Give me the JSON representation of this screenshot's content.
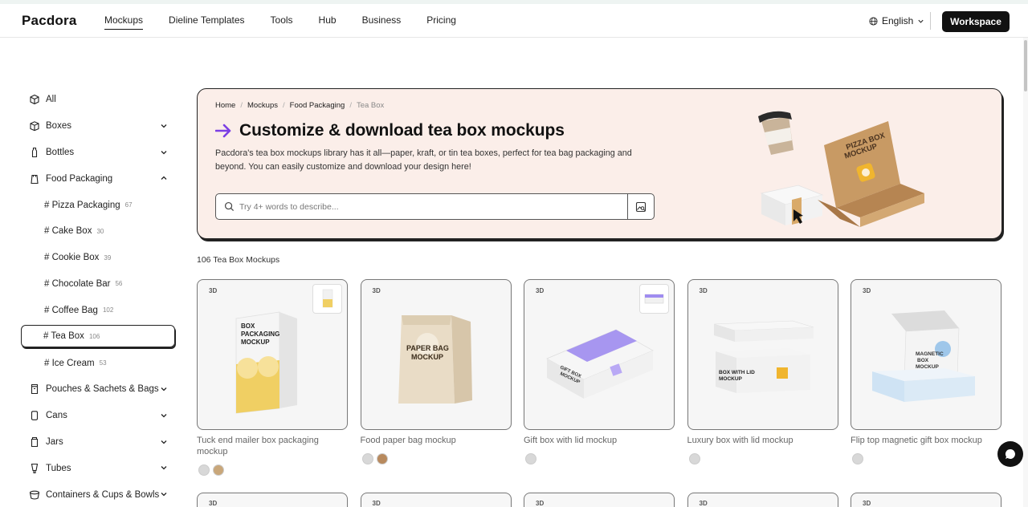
{
  "header": {
    "logo": "Pacdora",
    "nav": [
      "Mockups",
      "Dieline Templates",
      "Tools",
      "Hub",
      "Business",
      "Pricing"
    ],
    "language": "English",
    "workspace_label": "Workspace"
  },
  "sidebar": {
    "items": [
      {
        "label": "All",
        "icon": "cube-icon"
      },
      {
        "label": "Boxes",
        "icon": "box-icon"
      },
      {
        "label": "Bottles",
        "icon": "bottle-icon"
      },
      {
        "label": "Food Packaging",
        "icon": "food-bag-icon"
      },
      {
        "label": "# Pizza Packaging",
        "count": "67"
      },
      {
        "label": "# Cake Box",
        "count": "30"
      },
      {
        "label": "# Cookie Box",
        "count": "39"
      },
      {
        "label": "# Chocolate Bar",
        "count": "56"
      },
      {
        "label": "# Coffee Bag",
        "count": "102"
      },
      {
        "label": "# Tea Box",
        "count": "106"
      },
      {
        "label": "# Ice Cream",
        "count": "53"
      },
      {
        "label": "Pouches & Sachets & Bags",
        "icon": "pouch-icon"
      },
      {
        "label": "Cans",
        "icon": "can-icon"
      },
      {
        "label": "Jars",
        "icon": "jar-icon"
      },
      {
        "label": "Tubes",
        "icon": "tube-icon"
      },
      {
        "label": "Containers & Cups & Bowls",
        "icon": "bowl-icon"
      }
    ]
  },
  "hero": {
    "breadcrumbs": [
      "Home",
      "Mockups",
      "Food Packaging",
      "Tea Box"
    ],
    "title": "Customize & download tea box mockups",
    "description": "Pacdora's tea box mockups library has it all—paper, kraft, or tin tea boxes, perfect for tea bag packaging and beyond. You can easily customize and download your design here!",
    "search_placeholder": "Try 4+ words to describe...",
    "art_text_line1": "PIZZA BOX",
    "art_text_line2": "MOCKUP"
  },
  "results_count": "106 Tea Box Mockups",
  "cards": [
    {
      "badge": "3D",
      "title": "Tuck end mailer box packaging mockup",
      "art_line1": "BOX",
      "art_line2": "PACKAGING",
      "art_line3": "MOCKUP",
      "swatches": [
        "#d8d8d8",
        "#c9a77a"
      ]
    },
    {
      "badge": "3D",
      "title": "Food paper bag mockup",
      "art_line1": "PAPER BAG",
      "art_line2": "MOCKUP",
      "swatches": [
        "#d8d8d8",
        "#b88a5e"
      ]
    },
    {
      "badge": "3D",
      "title": "Gift box with lid mockup",
      "art_line1": "GIFT BOX",
      "art_line2": "MOCKUP",
      "swatches": [
        "#d8d8d8"
      ]
    },
    {
      "badge": "3D",
      "title": "Luxury box with lid mockup",
      "art_line1": "BOX WITH LID",
      "art_line2": "MOCKUP",
      "swatches": [
        "#d8d8d8"
      ]
    },
    {
      "badge": "3D",
      "title": "Flip top magnetic gift box mockup",
      "art_line1": "MAGNETIC",
      "art_line2": "BOX",
      "art_line3": "MOCKUP",
      "swatches": [
        "#d8d8d8"
      ]
    }
  ],
  "colors": {
    "accent_purple": "#7b3fe4",
    "hero_bg": "#fbeee9",
    "kraft": "#c89a64",
    "yellow": "#f0cf63",
    "lavender": "#9f8cf0"
  }
}
